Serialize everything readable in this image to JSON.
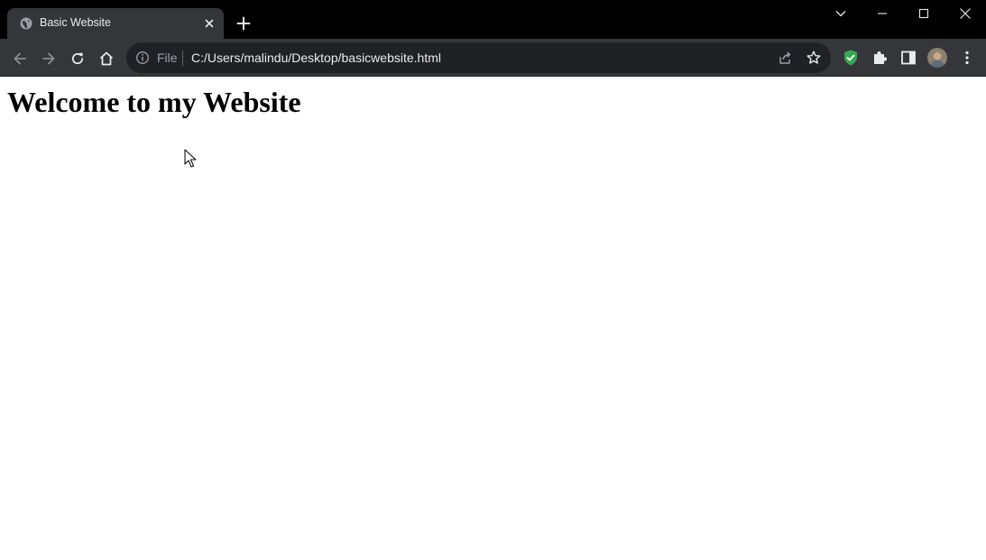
{
  "tab": {
    "title": "Basic Website",
    "favicon": "globe-icon"
  },
  "omnibox": {
    "scheme_label": "File",
    "url": "C:/Users/malindu/Desktop/basicwebsite.html"
  },
  "page": {
    "heading": "Welcome to my Website"
  },
  "colors": {
    "titlebar": "#000000",
    "toolbar": "#35363a",
    "omnibox": "#202124",
    "shield_accent": "#34a853"
  },
  "icons": [
    "globe-icon",
    "close-icon",
    "plus-icon",
    "chevron-down-icon",
    "minimize-icon",
    "maximize-icon",
    "close-window-icon",
    "back-arrow-icon",
    "forward-arrow-icon",
    "reload-icon",
    "home-icon",
    "info-icon",
    "share-icon",
    "star-icon",
    "shield-icon",
    "puzzle-icon",
    "side-panel-icon",
    "kebab-menu-icon",
    "mouse-cursor-icon"
  ]
}
